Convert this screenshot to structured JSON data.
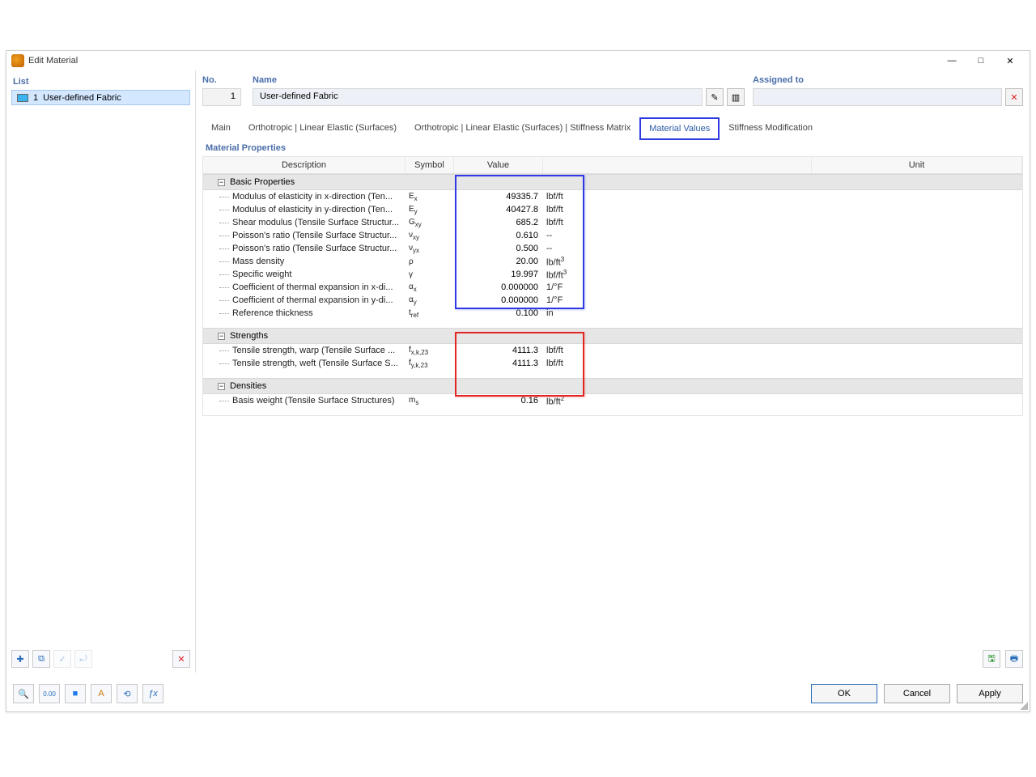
{
  "window": {
    "title": "Edit Material"
  },
  "win_controls": {
    "min": "—",
    "max": "□",
    "close": "✕"
  },
  "left": {
    "header": "List",
    "items": [
      {
        "num": "1",
        "name": "User-defined Fabric"
      }
    ],
    "toolbar": {
      "new": "✚",
      "copy": "⧉",
      "check": "✓",
      "auto": "⤾",
      "delete": "✕"
    }
  },
  "form": {
    "no_label": "No.",
    "no_value": "1",
    "name_label": "Name",
    "name_value": "User-defined Fabric",
    "assigned_label": "Assigned to",
    "assigned_value": "",
    "edit_icon": "✎",
    "lib_icon": "▥",
    "clear_icon": "✕"
  },
  "tabs": [
    {
      "label": "Main"
    },
    {
      "label": "Orthotropic | Linear Elastic (Surfaces)"
    },
    {
      "label": "Orthotropic | Linear Elastic (Surfaces) | Stiffness Matrix"
    },
    {
      "label": "Material Values"
    },
    {
      "label": "Stiffness Modification"
    }
  ],
  "section_title": "Material Properties",
  "columns": {
    "c0": "Description",
    "c1": "Symbol",
    "c2": "Value",
    "c3": "Unit"
  },
  "groups": [
    {
      "name": "Basic Properties",
      "rows": [
        {
          "desc": "Modulus of elasticity in x-direction (Ten...",
          "sym": "E<sub>x</sub>",
          "val": "49335.7",
          "unit": "lbf/ft"
        },
        {
          "desc": "Modulus of elasticity in y-direction (Ten...",
          "sym": "E<sub>y</sub>",
          "val": "40427.8",
          "unit": "lbf/ft"
        },
        {
          "desc": "Shear modulus (Tensile Surface Structur...",
          "sym": "G<sub>xy</sub>",
          "val": "685.2",
          "unit": "lbf/ft"
        },
        {
          "desc": "Poisson's ratio (Tensile Surface Structur...",
          "sym": "ν<sub>xy</sub>",
          "val": "0.610",
          "unit": "--"
        },
        {
          "desc": "Poisson's ratio (Tensile Surface Structur...",
          "sym": "ν<sub>yx</sub>",
          "val": "0.500",
          "unit": "--"
        },
        {
          "desc": "Mass density",
          "sym": "ρ",
          "val": "20.00",
          "unit": "lb/ft<sup>3</sup>"
        },
        {
          "desc": "Specific weight",
          "sym": "γ",
          "val": "19.997",
          "unit": "lbf/ft<sup>3</sup>"
        },
        {
          "desc": "Coefficient of thermal expansion in x-di...",
          "sym": "α<sub>x</sub>",
          "val": "0.000000",
          "unit": "1/°F"
        },
        {
          "desc": "Coefficient of thermal expansion in y-di...",
          "sym": "α<sub>y</sub>",
          "val": "0.000000",
          "unit": "1/°F"
        },
        {
          "desc": "Reference thickness",
          "sym": "t<sub>ref</sub>",
          "val": "0.100",
          "unit": "in",
          "dotted": true
        }
      ]
    },
    {
      "name": "Strengths",
      "rows": [
        {
          "desc": "Tensile strength, warp (Tensile Surface ...",
          "sym": "f<sub>x,k,23</sub>",
          "val": "4111.3",
          "unit": "lbf/ft"
        },
        {
          "desc": "Tensile strength, weft (Tensile Surface S...",
          "sym": "f<sub>y,k,23</sub>",
          "val": "4111.3",
          "unit": "lbf/ft"
        }
      ]
    },
    {
      "name": "Densities",
      "rows": [
        {
          "desc": "Basis weight (Tensile Surface Structures)",
          "sym": "m<sub>s</sub>",
          "val": "0.16",
          "unit": "lb/ft<sup>2</sup>"
        }
      ]
    }
  ],
  "buttons": {
    "ok": "OK",
    "cancel": "Cancel",
    "apply": "Apply"
  },
  "right_bottom": {
    "save": "🖫",
    "print": "🖶"
  },
  "footer_icons": {
    "i0": "🔍",
    "i1": "0.00",
    "i2": "■",
    "i3": "A",
    "i4": "⟲",
    "i5": "ƒx"
  }
}
